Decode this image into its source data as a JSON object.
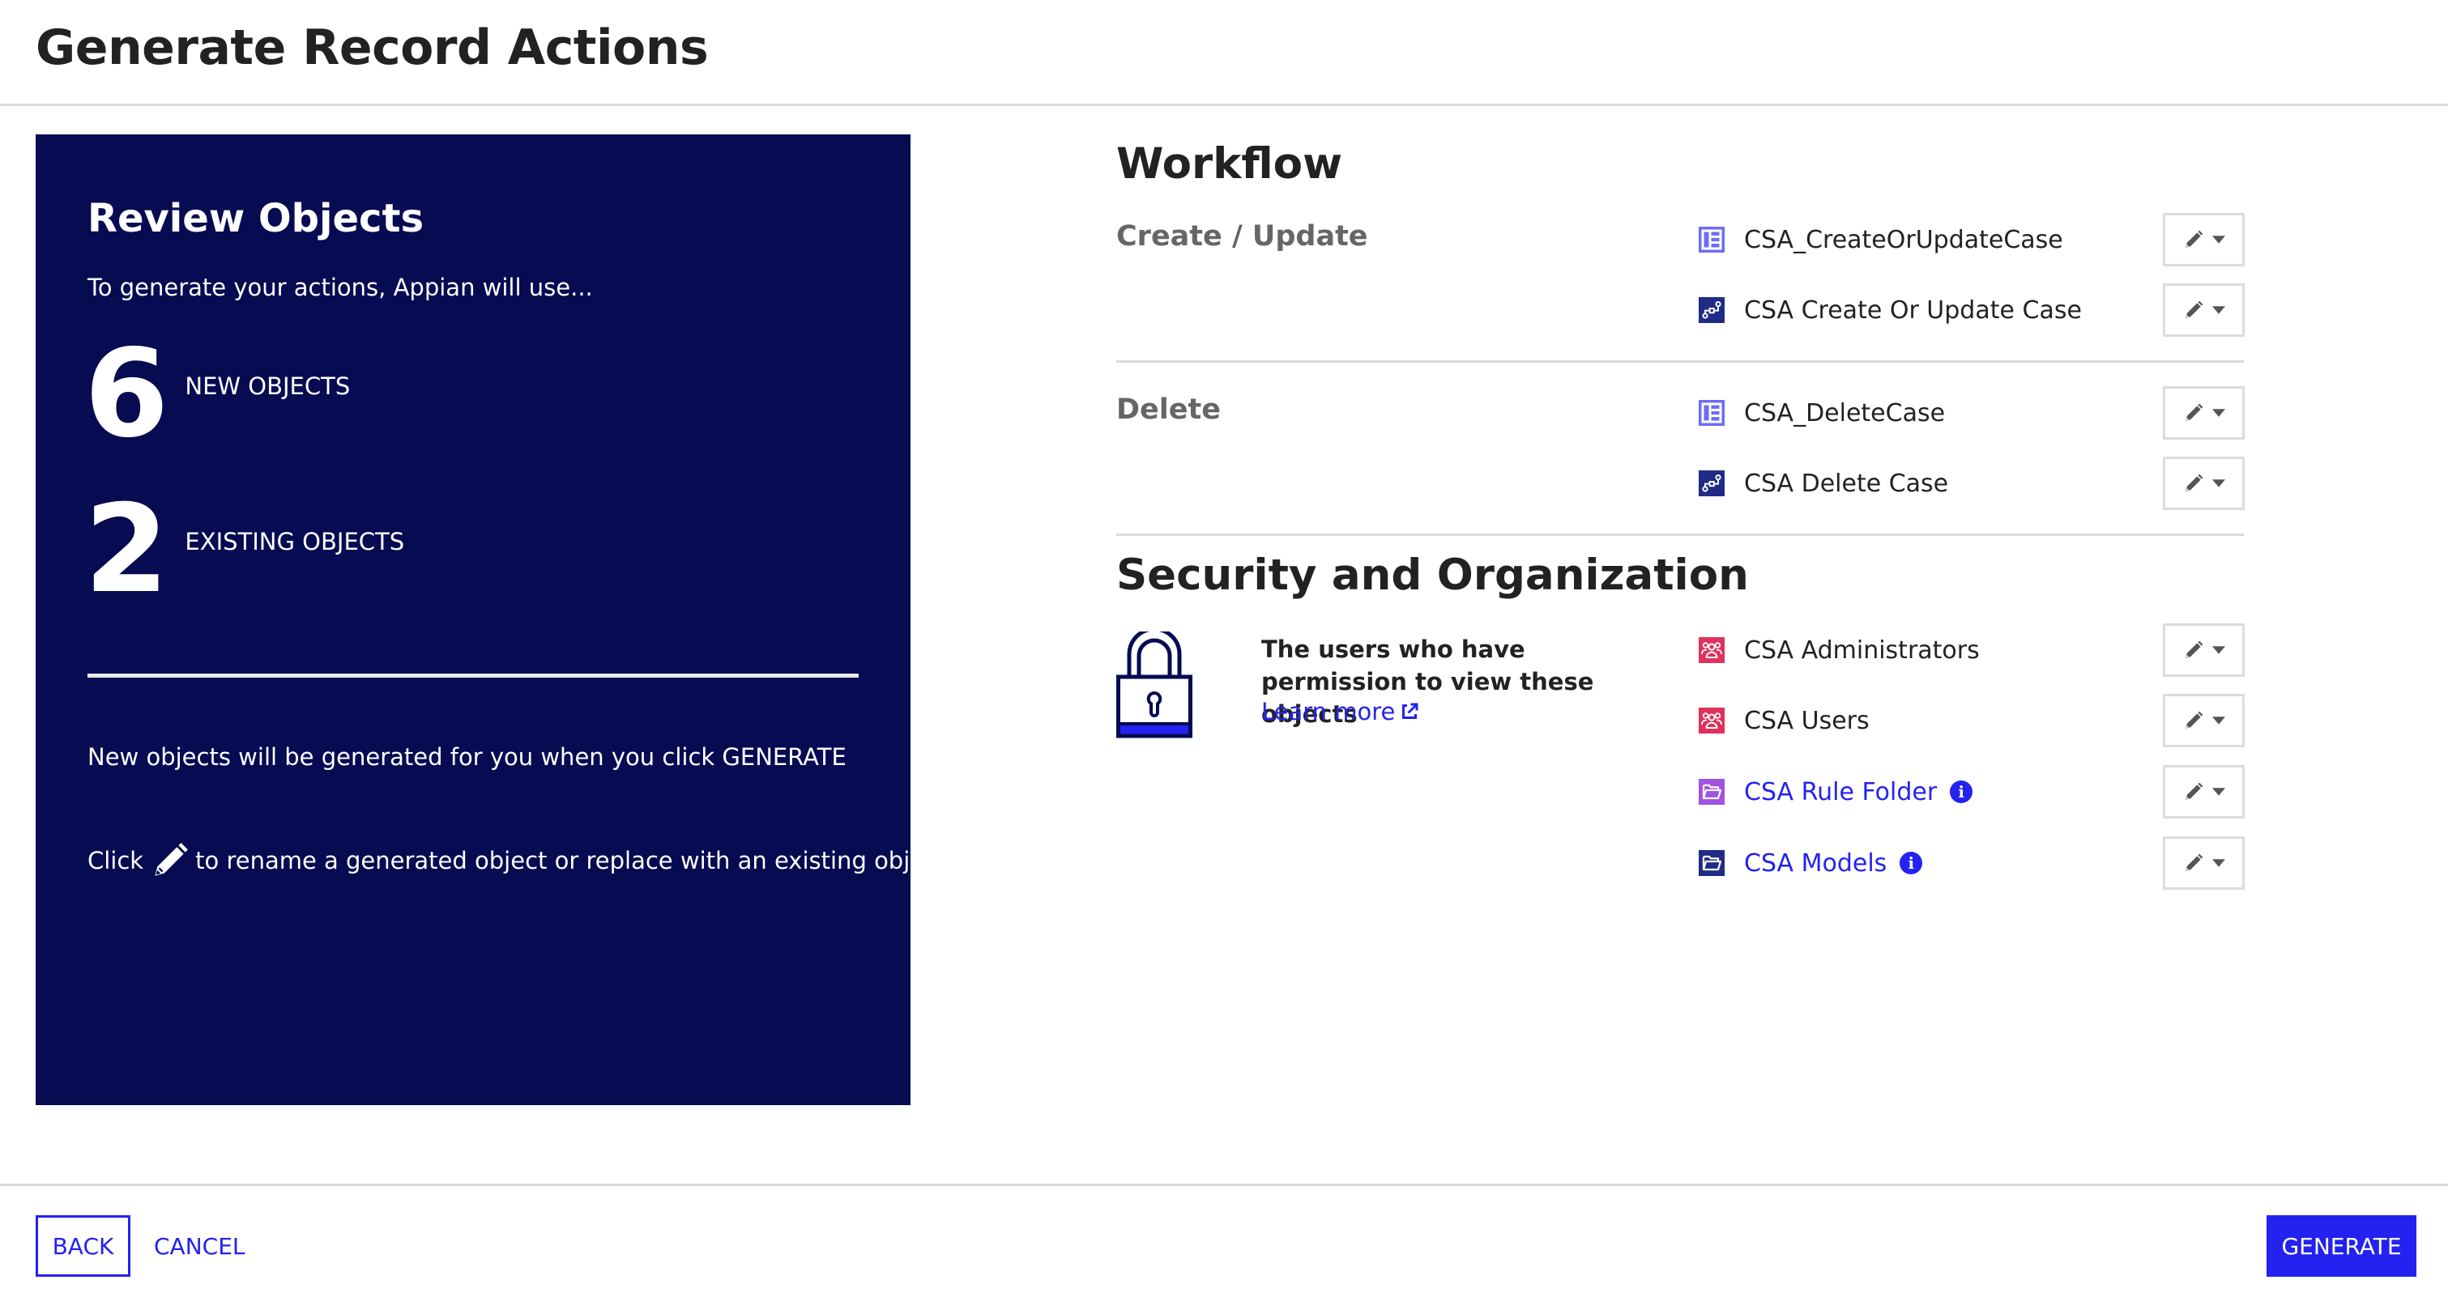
{
  "header": {
    "title": "Generate Record Actions"
  },
  "review_panel": {
    "title": "Review Objects",
    "intro": "To generate your actions, Appian will use...",
    "new_count": "6",
    "new_label": "NEW OBJECTS",
    "existing_count": "2",
    "existing_label": "EXISTING OBJECTS",
    "note": "New objects will be generated for you when you click GENERATE",
    "hint_prefix": "Click",
    "hint_suffix": "to rename a generated object or replace with an existing object",
    "colors": {
      "background": "#060b52",
      "text": "#ffffff"
    }
  },
  "workflow": {
    "heading": "Workflow",
    "groups": [
      {
        "label": "Create / Update",
        "items": [
          {
            "name": "CSA_CreateOrUpdateCase",
            "icon": "interface-icon",
            "link": false
          },
          {
            "name": "CSA Create Or Update Case",
            "icon": "process-model-icon",
            "link": false
          }
        ]
      },
      {
        "label": "Delete",
        "items": [
          {
            "name": "CSA_DeleteCase",
            "icon": "interface-icon",
            "link": false
          },
          {
            "name": "CSA Delete Case",
            "icon": "process-model-icon",
            "link": false
          }
        ]
      }
    ]
  },
  "security": {
    "heading": "Security and Organization",
    "description": "The users who have permission to view these objects",
    "learn_more": "Learn more",
    "items": [
      {
        "name": "CSA Administrators",
        "icon": "group-icon",
        "link": false,
        "info": false
      },
      {
        "name": "CSA Users",
        "icon": "group-icon",
        "link": false,
        "info": false
      },
      {
        "name": "CSA Rule Folder",
        "icon": "rule-folder-icon",
        "link": true,
        "info": true
      },
      {
        "name": "CSA Models",
        "icon": "model-folder-icon",
        "link": true,
        "info": true
      }
    ]
  },
  "footer": {
    "back_label": "BACK",
    "cancel_label": "CANCEL",
    "generate_label": "GENERATE"
  },
  "colors": {
    "accent": "#2322f0",
    "interface_icon": "#6d6cf5",
    "process_model_icon": "#1f2b86",
    "group_icon": "#e0325a",
    "rule_folder_icon": "#a052e0",
    "model_folder_icon": "#1f2b86",
    "divider": "#d9d9d9"
  }
}
